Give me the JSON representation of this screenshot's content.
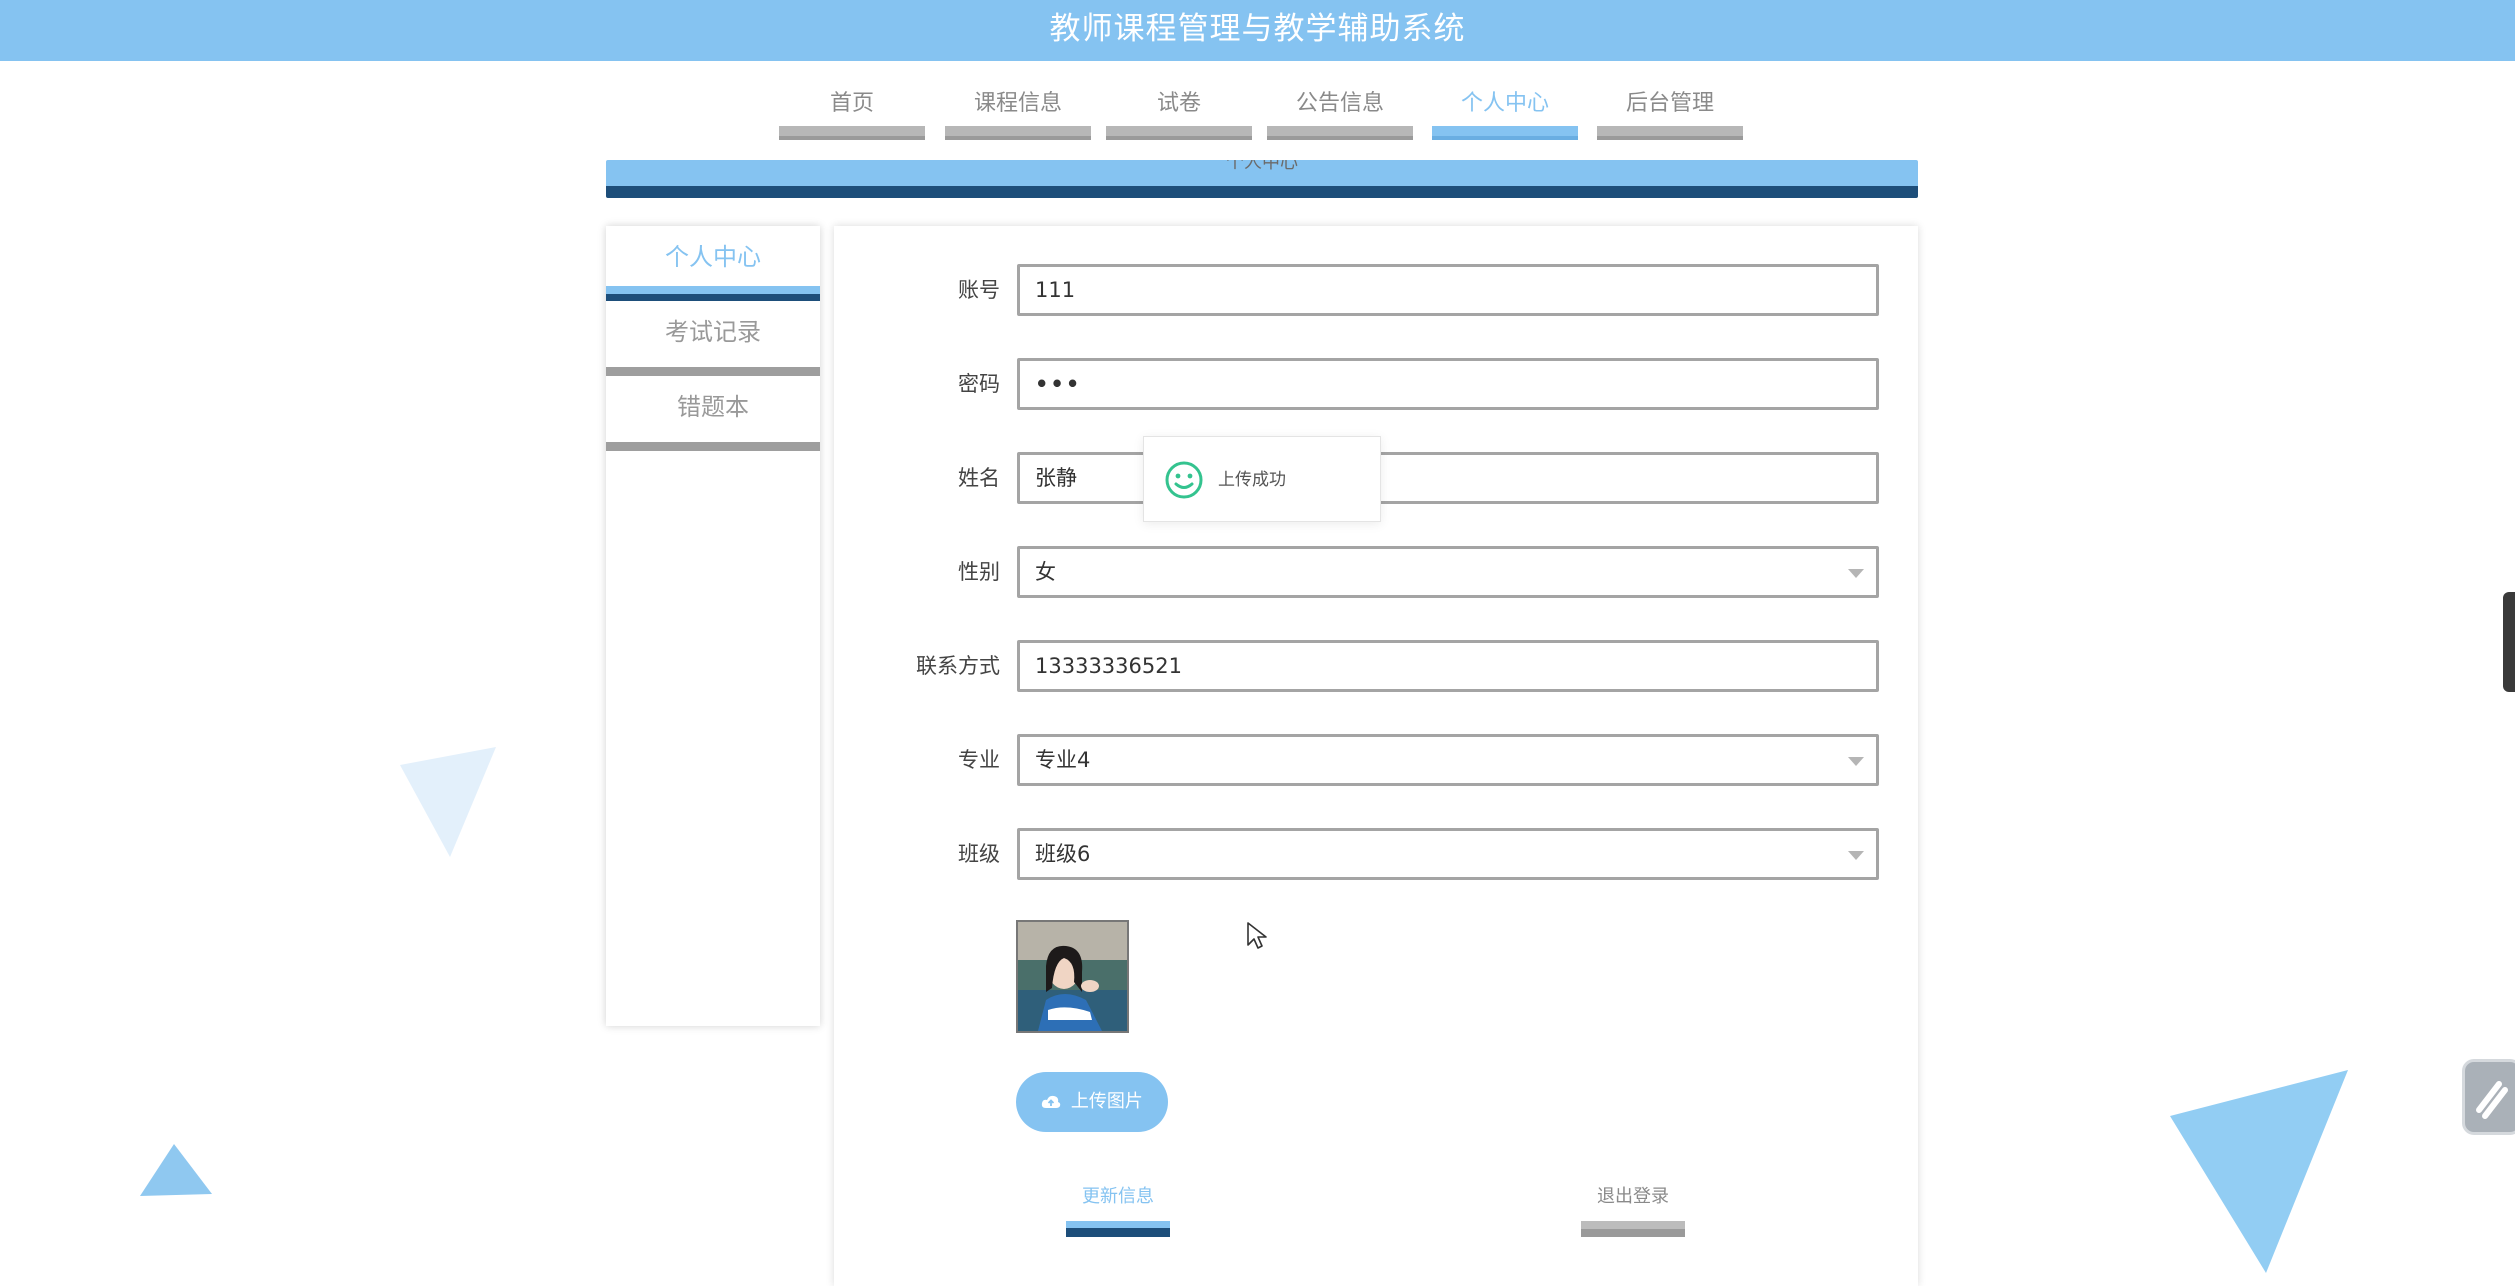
{
  "app": {
    "title": "教师课程管理与教学辅助系统"
  },
  "nav": {
    "items": [
      {
        "label": "首页"
      },
      {
        "label": "课程信息"
      },
      {
        "label": "试卷"
      },
      {
        "label": "公告信息"
      },
      {
        "label": "个人中心",
        "active": true
      },
      {
        "label": "后台管理"
      }
    ]
  },
  "banner": {
    "title": "个人中心"
  },
  "sidebar": {
    "items": [
      {
        "label": "个人中心",
        "active": true
      },
      {
        "label": "考试记录"
      },
      {
        "label": "错题本"
      }
    ]
  },
  "form": {
    "account": {
      "label": "账号",
      "value": "111"
    },
    "password": {
      "label": "密码",
      "value": "•••"
    },
    "name": {
      "label": "姓名",
      "value": "张静"
    },
    "gender": {
      "label": "性别",
      "value": "女"
    },
    "contact": {
      "label": "联系方式",
      "value": "13333336521"
    },
    "major": {
      "label": "专业",
      "value": "专业4"
    },
    "class": {
      "label": "班级",
      "value": "班级6"
    }
  },
  "toast": {
    "message": "上传成功",
    "icon": "smiley-icon"
  },
  "upload": {
    "label": "上传图片",
    "icon": "cloud-upload-icon"
  },
  "actions": {
    "update": "更新信息",
    "logout": "退出登录"
  },
  "colors": {
    "accent": "#85c3f1",
    "dark": "#1d4e7a",
    "gray": "#9e9e9e",
    "success": "#34c38f"
  }
}
